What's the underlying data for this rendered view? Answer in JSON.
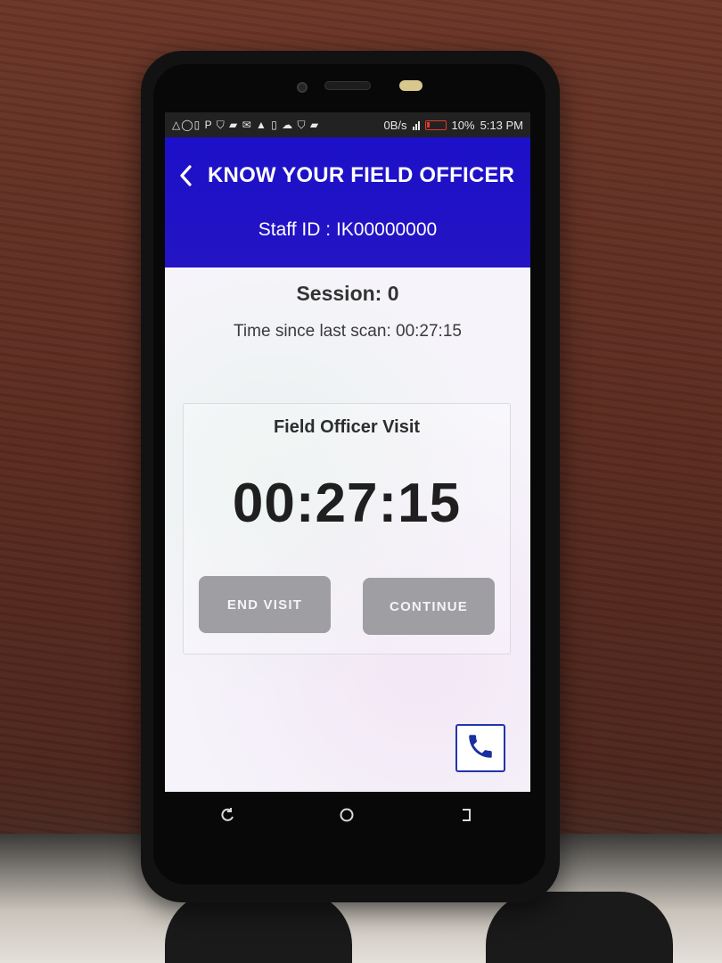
{
  "status_bar": {
    "left_icons": "△◯▯ P ⛉ ▰ ✉ ▲ ▯ ☁ ⛉ ▰",
    "data_rate": "0B/s",
    "battery": "10%",
    "time": "5:13 PM"
  },
  "header": {
    "title": "KNOW YOUR FIELD OFFICER",
    "staff_label": "Staff ID :",
    "staff_id": "IK00000000"
  },
  "main": {
    "session": "Session: 0",
    "time_since": "Time since last scan: 00:27:15"
  },
  "card": {
    "title": "Field Officer Visit",
    "timer": "00:27:15",
    "end_visit_label": "END VISIT",
    "continue_label": "CONTINUE"
  },
  "icons": {
    "back": "chevron-left-icon",
    "call": "phone-icon",
    "nav_back": "back-icon",
    "nav_home": "home-icon",
    "nav_recent": "recent-apps-icon"
  },
  "colors": {
    "appbar": "#2414c4",
    "button": "#9f9ea3",
    "call_icon": "#1a2fa0"
  }
}
